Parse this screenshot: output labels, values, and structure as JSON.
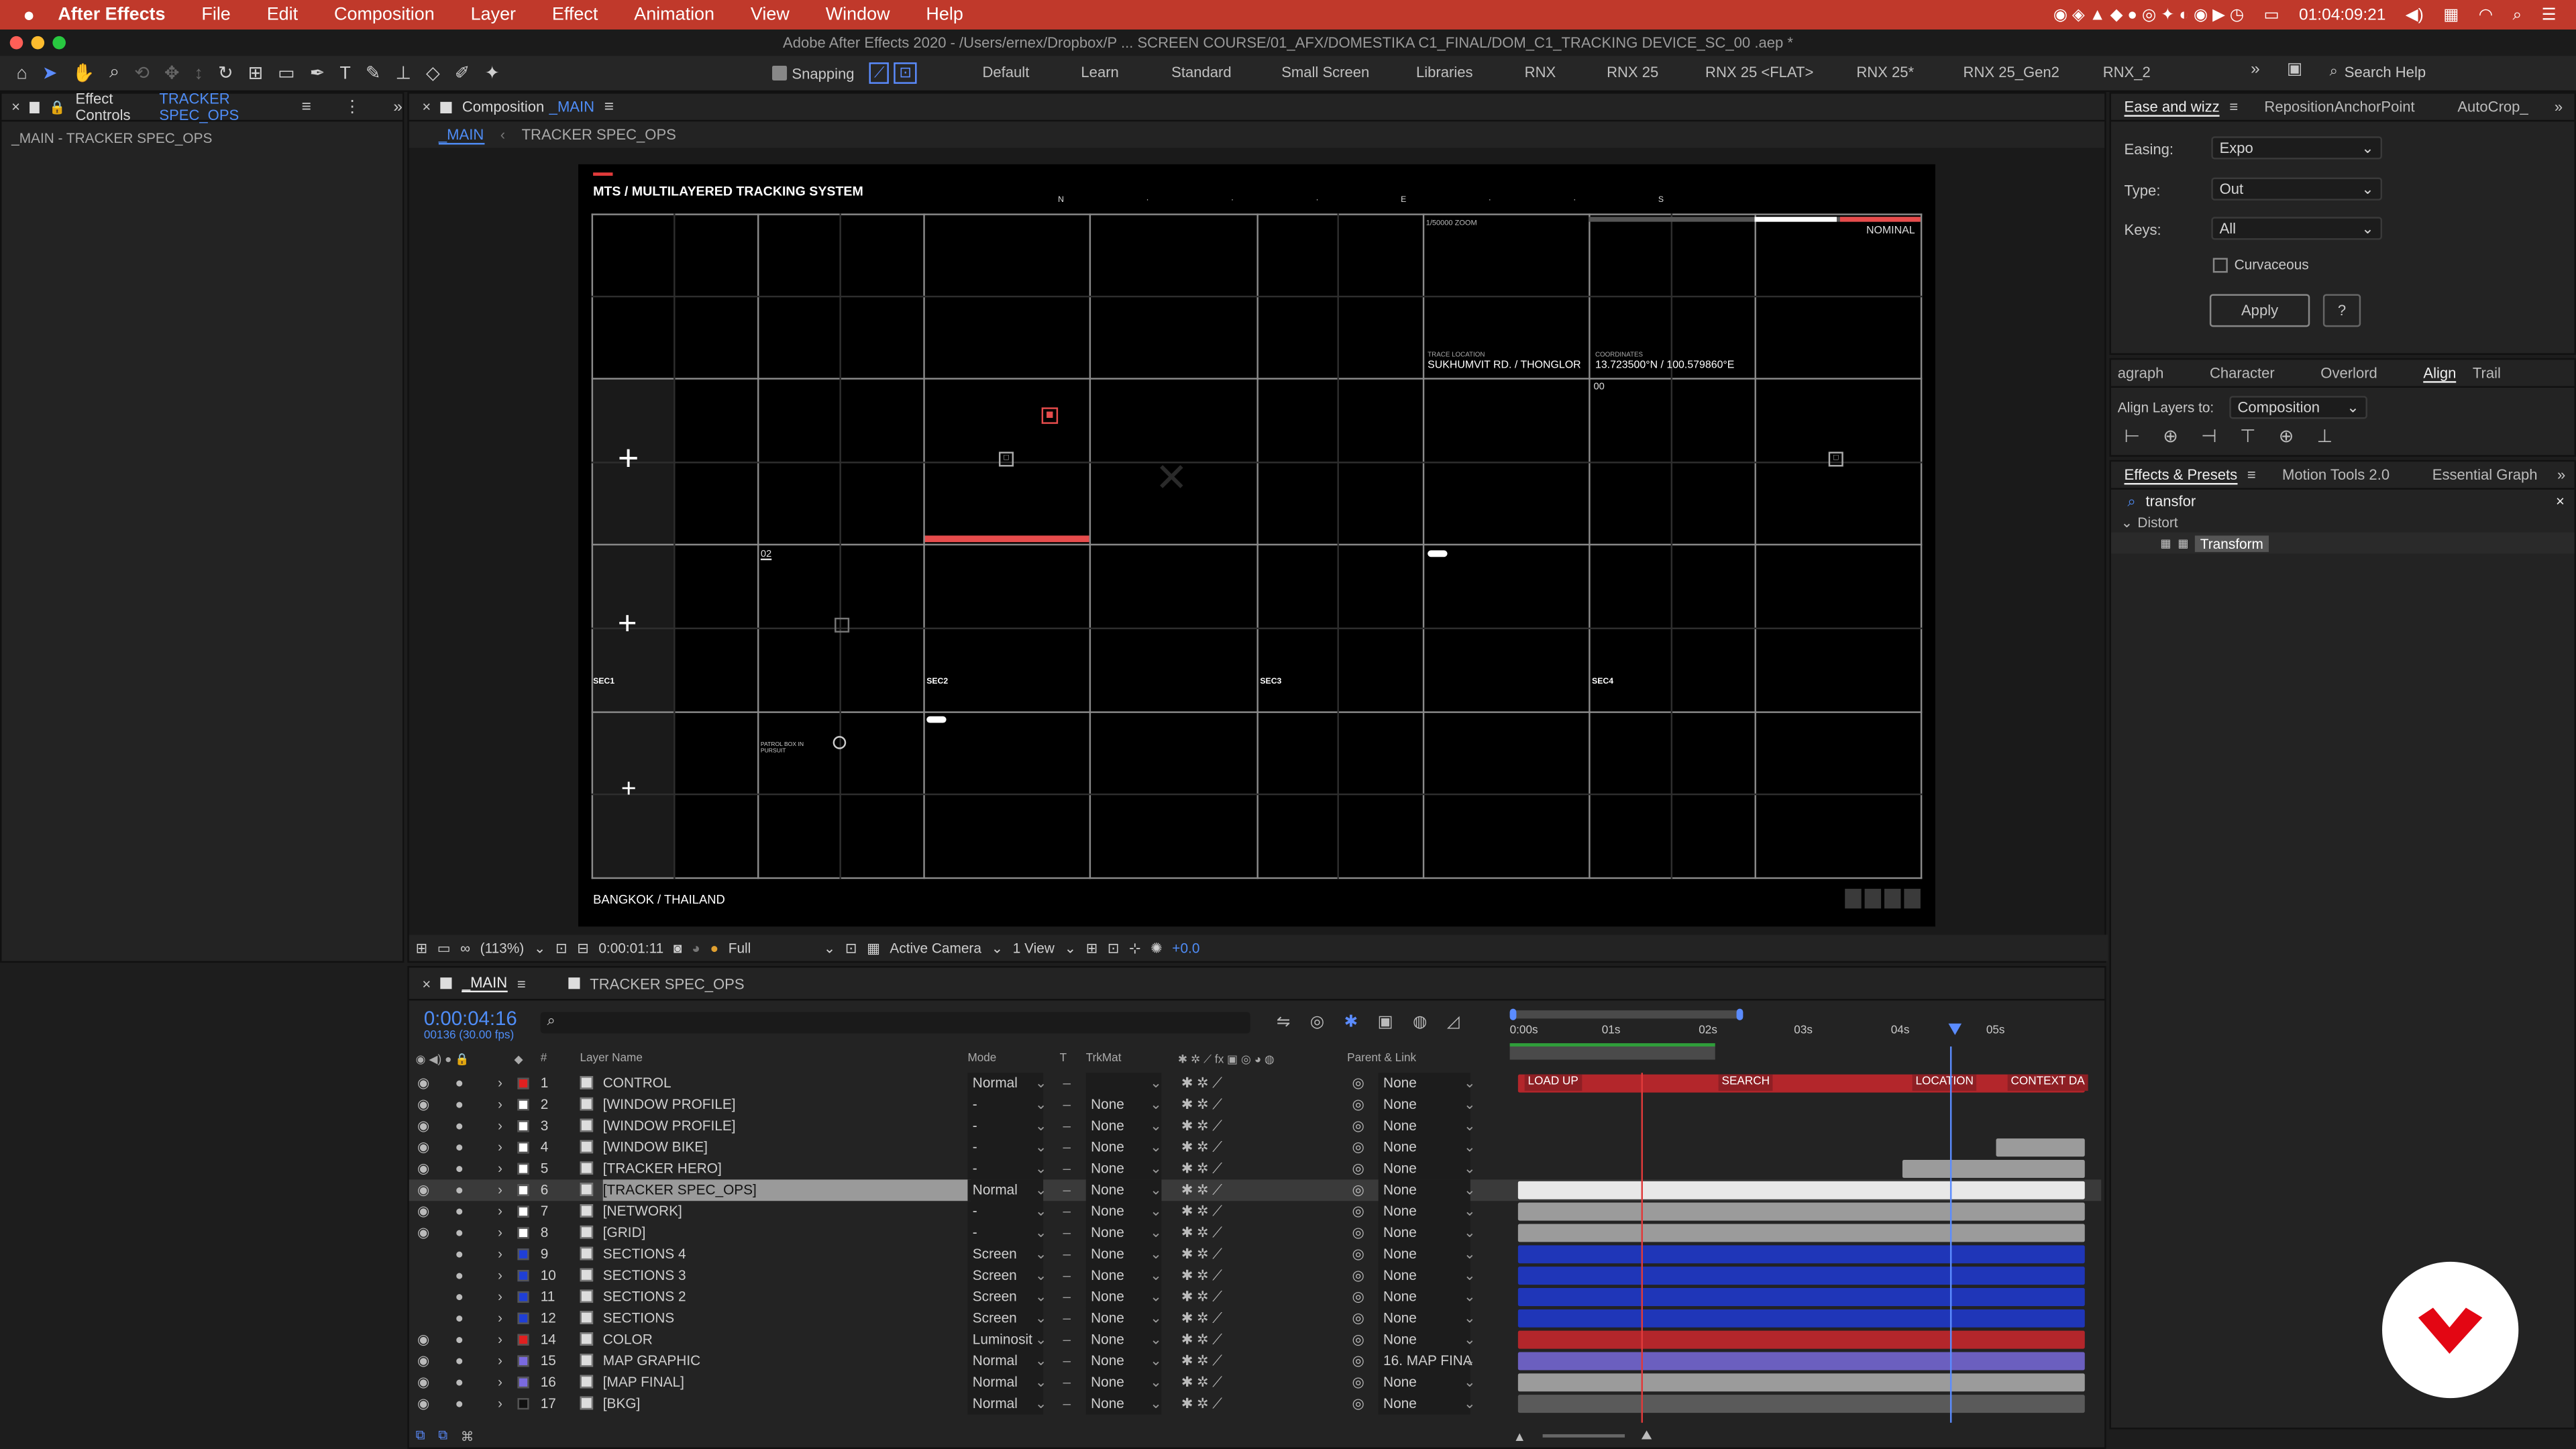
{
  "menubar": {
    "app": "After Effects",
    "items": [
      "File",
      "Edit",
      "Composition",
      "Layer",
      "Effect",
      "Animation",
      "View",
      "Window",
      "Help"
    ],
    "clock": "01:04:09:21"
  },
  "window_title": "Adobe After Effects 2020 - /Users/ernex/Dropbox/P ... SCREEN COURSE/01_AFX/DOMESTIKA C1_FINAL/DOM_C1_TRACKING DEVICE_SC_00 .aep *",
  "toolbar": {
    "snapping": "Snapping",
    "workspaces": [
      "Default",
      "Learn",
      "Standard",
      "Small Screen",
      "Libraries",
      "RNX",
      "RNX 25",
      "RNX 25 <FLAT>",
      "RNX 25*",
      "RNX 25_Gen2",
      "RNX_2"
    ],
    "search_placeholder": "Search Help"
  },
  "effect_controls": {
    "tab": "Effect Controls",
    "layer": "TRACKER SPEC_OPS",
    "subtitle": "_MAIN - TRACKER SPEC_OPS"
  },
  "composition": {
    "tab": "Composition",
    "name": "_MAIN",
    "breadcrumbs": [
      "_MAIN",
      "TRACKER SPEC_OPS"
    ]
  },
  "viewer": {
    "title": "MTS / MULTILAYERED TRACKING SYSTEM",
    "compass": [
      "N",
      "E",
      "S"
    ],
    "zoom_label": "1/50000 ZOOM",
    "trace_label": "TRACE LOCATION",
    "trace_value": "SUKHUMVIT RD. / THONGLOR",
    "coords_label": "COORDINATES",
    "coords_value": "13.723500°N / 100.579860°E",
    "status": "NOMINAL",
    "sec": [
      "SEC1",
      "SEC2",
      "SEC3",
      "SEC4"
    ],
    "patrol": "PATROL BOX IN PURSUIT",
    "footer": "BANGKOK / THAILAND",
    "num02": "02",
    "num00": "00"
  },
  "viewer_controls": {
    "zoom": "(113%)",
    "time": "0:00:01:11",
    "resolution": "Full",
    "camera": "Active Camera",
    "views": "1 View",
    "exposure": "+0.0"
  },
  "ease": {
    "tab": "Ease and wizz",
    "tab2": "RepositionAnchorPoint",
    "tab3": "AutoCrop_",
    "easing_label": "Easing:",
    "easing": "Expo",
    "type_label": "Type:",
    "type": "Out",
    "keys_label": "Keys:",
    "keys": "All",
    "curvaceous": "Curvaceous",
    "apply": "Apply",
    "help": "?"
  },
  "align": {
    "tabs": [
      "agraph",
      "Character",
      "Overlord",
      "Align",
      "Trail"
    ],
    "label": "Align Layers to:",
    "target": "Composition"
  },
  "effects": {
    "tabs": [
      "Effects & Presets",
      "Motion Tools 2.0",
      "Essential Graph"
    ],
    "search": "transfor",
    "category": "Distort",
    "item": "Transform"
  },
  "timeline": {
    "tab": "_MAIN",
    "tab2": "TRACKER SPEC_OPS",
    "time": "0:00:04:16",
    "frames": "00136 (30.00 fps)",
    "headers": {
      "num": "#",
      "name": "Layer Name",
      "mode": "Mode",
      "t": "T",
      "trkmat": "TrkMat",
      "parent": "Parent & Link"
    },
    "ruler": [
      "0:00s",
      "01s",
      "02s",
      "03s",
      "04s",
      "05s"
    ],
    "markers": [
      "LOAD UP",
      "SEARCH",
      "LOCATION",
      "CONTEXT DA"
    ],
    "layers": [
      {
        "n": "1",
        "name": "CONTROL",
        "mode": "Normal",
        "trk": "",
        "parent": "None",
        "color": "#e02020",
        "eye": true
      },
      {
        "n": "2",
        "name": "[WINDOW PROFILE]",
        "mode": "-",
        "trk": "None",
        "parent": "None",
        "color": "#ffffff",
        "eye": true
      },
      {
        "n": "3",
        "name": "[WINDOW PROFILE]",
        "mode": "-",
        "trk": "None",
        "parent": "None",
        "color": "#ffffff",
        "eye": true
      },
      {
        "n": "4",
        "name": "[WINDOW BIKE]",
        "mode": "-",
        "trk": "None",
        "parent": "None",
        "color": "#ffffff",
        "eye": true
      },
      {
        "n": "5",
        "name": "[TRACKER HERO]",
        "mode": "-",
        "trk": "None",
        "parent": "None",
        "color": "#ffffff",
        "eye": true
      },
      {
        "n": "6",
        "name": "[TRACKER SPEC_OPS]",
        "mode": "Normal",
        "trk": "None",
        "parent": "None",
        "color": "#ffffff",
        "eye": true
      },
      {
        "n": "7",
        "name": "[NETWORK]",
        "mode": "-",
        "trk": "None",
        "parent": "None",
        "color": "#ffffff",
        "eye": true
      },
      {
        "n": "8",
        "name": "[GRID]",
        "mode": "-",
        "trk": "None",
        "parent": "None",
        "color": "#ffffff",
        "eye": true
      },
      {
        "n": "9",
        "name": "SECTIONS 4",
        "mode": "Screen",
        "trk": "None",
        "parent": "None",
        "color": "#1f3fd6",
        "eye": false
      },
      {
        "n": "10",
        "name": "SECTIONS 3",
        "mode": "Screen",
        "trk": "None",
        "parent": "None",
        "color": "#1f3fd6",
        "eye": false
      },
      {
        "n": "11",
        "name": "SECTIONS 2",
        "mode": "Screen",
        "trk": "None",
        "parent": "None",
        "color": "#1f3fd6",
        "eye": false
      },
      {
        "n": "12",
        "name": "SECTIONS",
        "mode": "Screen",
        "trk": "None",
        "parent": "None",
        "color": "#1f3fd6",
        "eye": false
      },
      {
        "n": "14",
        "name": "COLOR",
        "mode": "Luminosit",
        "trk": "None",
        "parent": "None",
        "color": "#e02020",
        "eye": true
      },
      {
        "n": "15",
        "name": "MAP GRAPHIC",
        "mode": "Normal",
        "trk": "None",
        "parent": "16. MAP FINA",
        "color": "#7a6ae0",
        "eye": true
      },
      {
        "n": "16",
        "name": "[MAP FINAL]",
        "mode": "Normal",
        "trk": "None",
        "parent": "None",
        "color": "#7a6ae0",
        "eye": true
      },
      {
        "n": "17",
        "name": "[BKG]",
        "mode": "Normal",
        "trk": "None",
        "parent": "None",
        "color": "#111111",
        "eye": true
      }
    ]
  },
  "colors": {
    "accent": "#c0392b",
    "blue": "#2b5bd6",
    "bluebar": "#1f36b8",
    "redbar": "#b3262b",
    "purplebar": "#6b5fbf",
    "graybar": "#9b9b9b"
  }
}
